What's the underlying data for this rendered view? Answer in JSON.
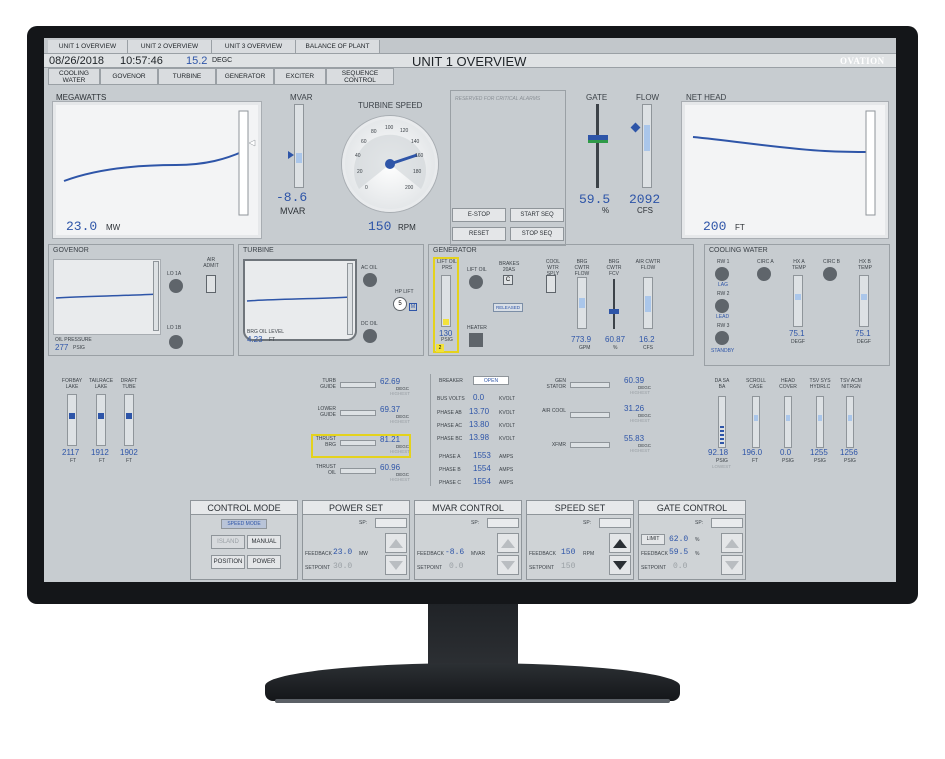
{
  "tabs": [
    "UNIT 1 OVERVIEW",
    "UNIT 2 OVERVIEW",
    "UNIT 3 OVERVIEW",
    "BALANCE OF PLANT"
  ],
  "header": {
    "date": "08/26/2018",
    "time": "10:57:46",
    "temp_value": "15.2",
    "temp_unit": "DEGC",
    "title": "UNIT 1 OVERVIEW",
    "brand": "OVATION"
  },
  "subnav": [
    "COOLING WATER",
    "GOVENOR",
    "TURBINE",
    "GENERATOR",
    "EXCITER",
    "SEQUENCE CONTROL"
  ],
  "megawatts": {
    "label": "MEGAWATTS",
    "value": "23.0",
    "unit": "MW"
  },
  "mvar": {
    "label": "MVAR",
    "value": "-8.6",
    "unit": "MVAR"
  },
  "turbine_speed": {
    "label": "TURBINE SPEED",
    "value": "150",
    "unit": "RPM",
    "ticks": [
      "0",
      "20",
      "40",
      "60",
      "80",
      "100",
      "120",
      "140",
      "160",
      "180",
      "200"
    ]
  },
  "alarm_note": "RESERVED FOR CRITICAL ALARMS",
  "buttons": {
    "estop": "E-STOP",
    "start": "START SEQ",
    "reset": "RESET",
    "stop": "STOP SEQ"
  },
  "gate": {
    "label": "GATE",
    "value": "59.5",
    "unit": "%"
  },
  "flow": {
    "label": "FLOW",
    "value": "2092",
    "unit": "CFS"
  },
  "net_head": {
    "label": "NET HEAD",
    "value": "200",
    "unit": "FT"
  },
  "governor": {
    "label": "GOVENOR",
    "lo1a": "LO 1A",
    "lo1b": "LO 1B",
    "air": "AIR ADMIT",
    "oil_label": "OIL PRESSURE",
    "oil_value": "277",
    "oil_unit": "PSIG"
  },
  "turbine": {
    "label": "TURBINE",
    "ac": "AC OIL",
    "dc": "DC OIL",
    "hp": "HP LIFT",
    "hp_num": "5",
    "m": "M",
    "brg_label": "BRG OIL LEVEL",
    "brg_value": "4.23",
    "brg_unit": "FT"
  },
  "generator": {
    "label": "GENERATOR",
    "lift_prs": "LIFT OIL PRS",
    "lift_oil": "LIFT OIL",
    "brakes": "BRAKES 20AS",
    "c": "C",
    "released": "RELEASED",
    "heater": "HEATER",
    "prs_value": "130",
    "prs_unit": "PSIG",
    "two": "2",
    "cool_sply": "COOL WTR SPLY",
    "brg_flow": "BRG CWTR FLOW",
    "brg_fcv": "BRG CWTR FCV",
    "air_flow": "AIR CWTR FLOW",
    "v1": "773.9",
    "u1": "GPM",
    "v2": "60.87",
    "u2": "%",
    "v3": "16.2",
    "u3": "CFS"
  },
  "cooling": {
    "label": "COOLING WATER",
    "rw1": "RW 1",
    "lag": "LAG",
    "rw2": "RW 2",
    "lead": "LEAD",
    "rw3": "RW 3",
    "standby": "STANDBY",
    "circa": "CIRC A",
    "hxa": "HX A TEMP",
    "circb": "CIRC B",
    "hxb": "HX B TEMP",
    "v1": "75.1",
    "v2": "75.1",
    "unit": "DEGF"
  },
  "levels": [
    {
      "name": "FORBAY LAKE",
      "value": "2117",
      "unit": "FT"
    },
    {
      "name": "TAILRACE LAKE",
      "value": "1912",
      "unit": "FT"
    },
    {
      "name": "DRAFT TUBE",
      "value": "1902",
      "unit": "FT"
    }
  ],
  "bearings": [
    {
      "name": "TURB GUIDE",
      "value": "62.69",
      "unit": "DEGC",
      "tag": "HIGHEST"
    },
    {
      "name": "LOWER GUIDE",
      "value": "69.37",
      "unit": "DEGC",
      "tag": "HIGHEST"
    },
    {
      "name": "THRUST BRG",
      "value": "81.21",
      "unit": "DEGC",
      "tag": "HIGHEST"
    },
    {
      "name": "THRUST OIL",
      "value": "60.96",
      "unit": "DEGC",
      "tag": "HIGHEST"
    }
  ],
  "electrical": {
    "breaker": "BREAKER",
    "breaker_state": "OPEN",
    "rows": [
      {
        "name": "BUS VOLTS",
        "value": "0.0",
        "unit": "KVOLT"
      },
      {
        "name": "PHASE AB",
        "value": "13.70",
        "unit": "KVOLT"
      },
      {
        "name": "PHASE AC",
        "value": "13.80",
        "unit": "KVOLT"
      },
      {
        "name": "PHASE BC",
        "value": "13.98",
        "unit": "KVOLT"
      },
      {
        "name": "PHASE A",
        "value": "1553",
        "unit": "AMPS"
      },
      {
        "name": "PHASE B",
        "value": "1554",
        "unit": "AMPS"
      },
      {
        "name": "PHASE C",
        "value": "1554",
        "unit": "AMPS"
      }
    ]
  },
  "gen_temps": [
    {
      "name": "GEN STATOR",
      "value": "60.39",
      "unit": "DEGC",
      "tag": "HIGHEST"
    },
    {
      "name": "AIR COOL",
      "value": "31.26",
      "unit": "DEGC",
      "tag": "HIGHEST"
    },
    {
      "name": "XFMR",
      "value": "55.83",
      "unit": "DEGC",
      "tag": "HIGHEST"
    }
  ],
  "aux": [
    {
      "name": "DA SA BA",
      "value": "92.18",
      "unit": "PSIG",
      "tag": "LOWEST"
    },
    {
      "name": "SCROLL CASE",
      "value": "196.0",
      "unit": "FT"
    },
    {
      "name": "HEAD COVER",
      "value": "0.0",
      "unit": "PSIG"
    },
    {
      "name": "TSV SYS HYDRLC",
      "value": "1255",
      "unit": "PSIG"
    },
    {
      "name": "TSV ACM NITRGN",
      "value": "1256",
      "unit": "PSIG"
    }
  ],
  "control_mode": {
    "title": "CONTROL MODE",
    "speed_mode": "SPEED MODE",
    "island": "ISLAND",
    "manual": "MANUAL",
    "position": "POSITION",
    "power": "POWER"
  },
  "power_set": {
    "title": "POWER SET",
    "sp": "SP:",
    "fb_label": "FEEDBACK",
    "fb": "23.0",
    "fb_unit": "MW",
    "sp_label": "SETPOINT",
    "spv": "30.0"
  },
  "mvar_control": {
    "title": "MVAR CONTROL",
    "sp": "SP:",
    "fb_label": "FEEDBACK",
    "fb": "-8.6",
    "fb_unit": "MVAR",
    "sp_label": "SETPOINT",
    "spv": "0.0"
  },
  "speed_set": {
    "title": "SPEED SET",
    "sp": "SP:",
    "fb_label": "FEEDBACK",
    "fb": "150",
    "fb_unit": "RPM",
    "sp_label": "SETPOINT",
    "spv": "150"
  },
  "gate_control": {
    "title": "GATE CONTROL",
    "sp": "SP:",
    "limit": "LIMIT",
    "limit_v": "62.0",
    "limit_u": "%",
    "fb_label": "FEEDBACK",
    "fb": "59.5",
    "fb_unit": "%",
    "sp_label": "SETPOINT",
    "spv": "0.0"
  }
}
